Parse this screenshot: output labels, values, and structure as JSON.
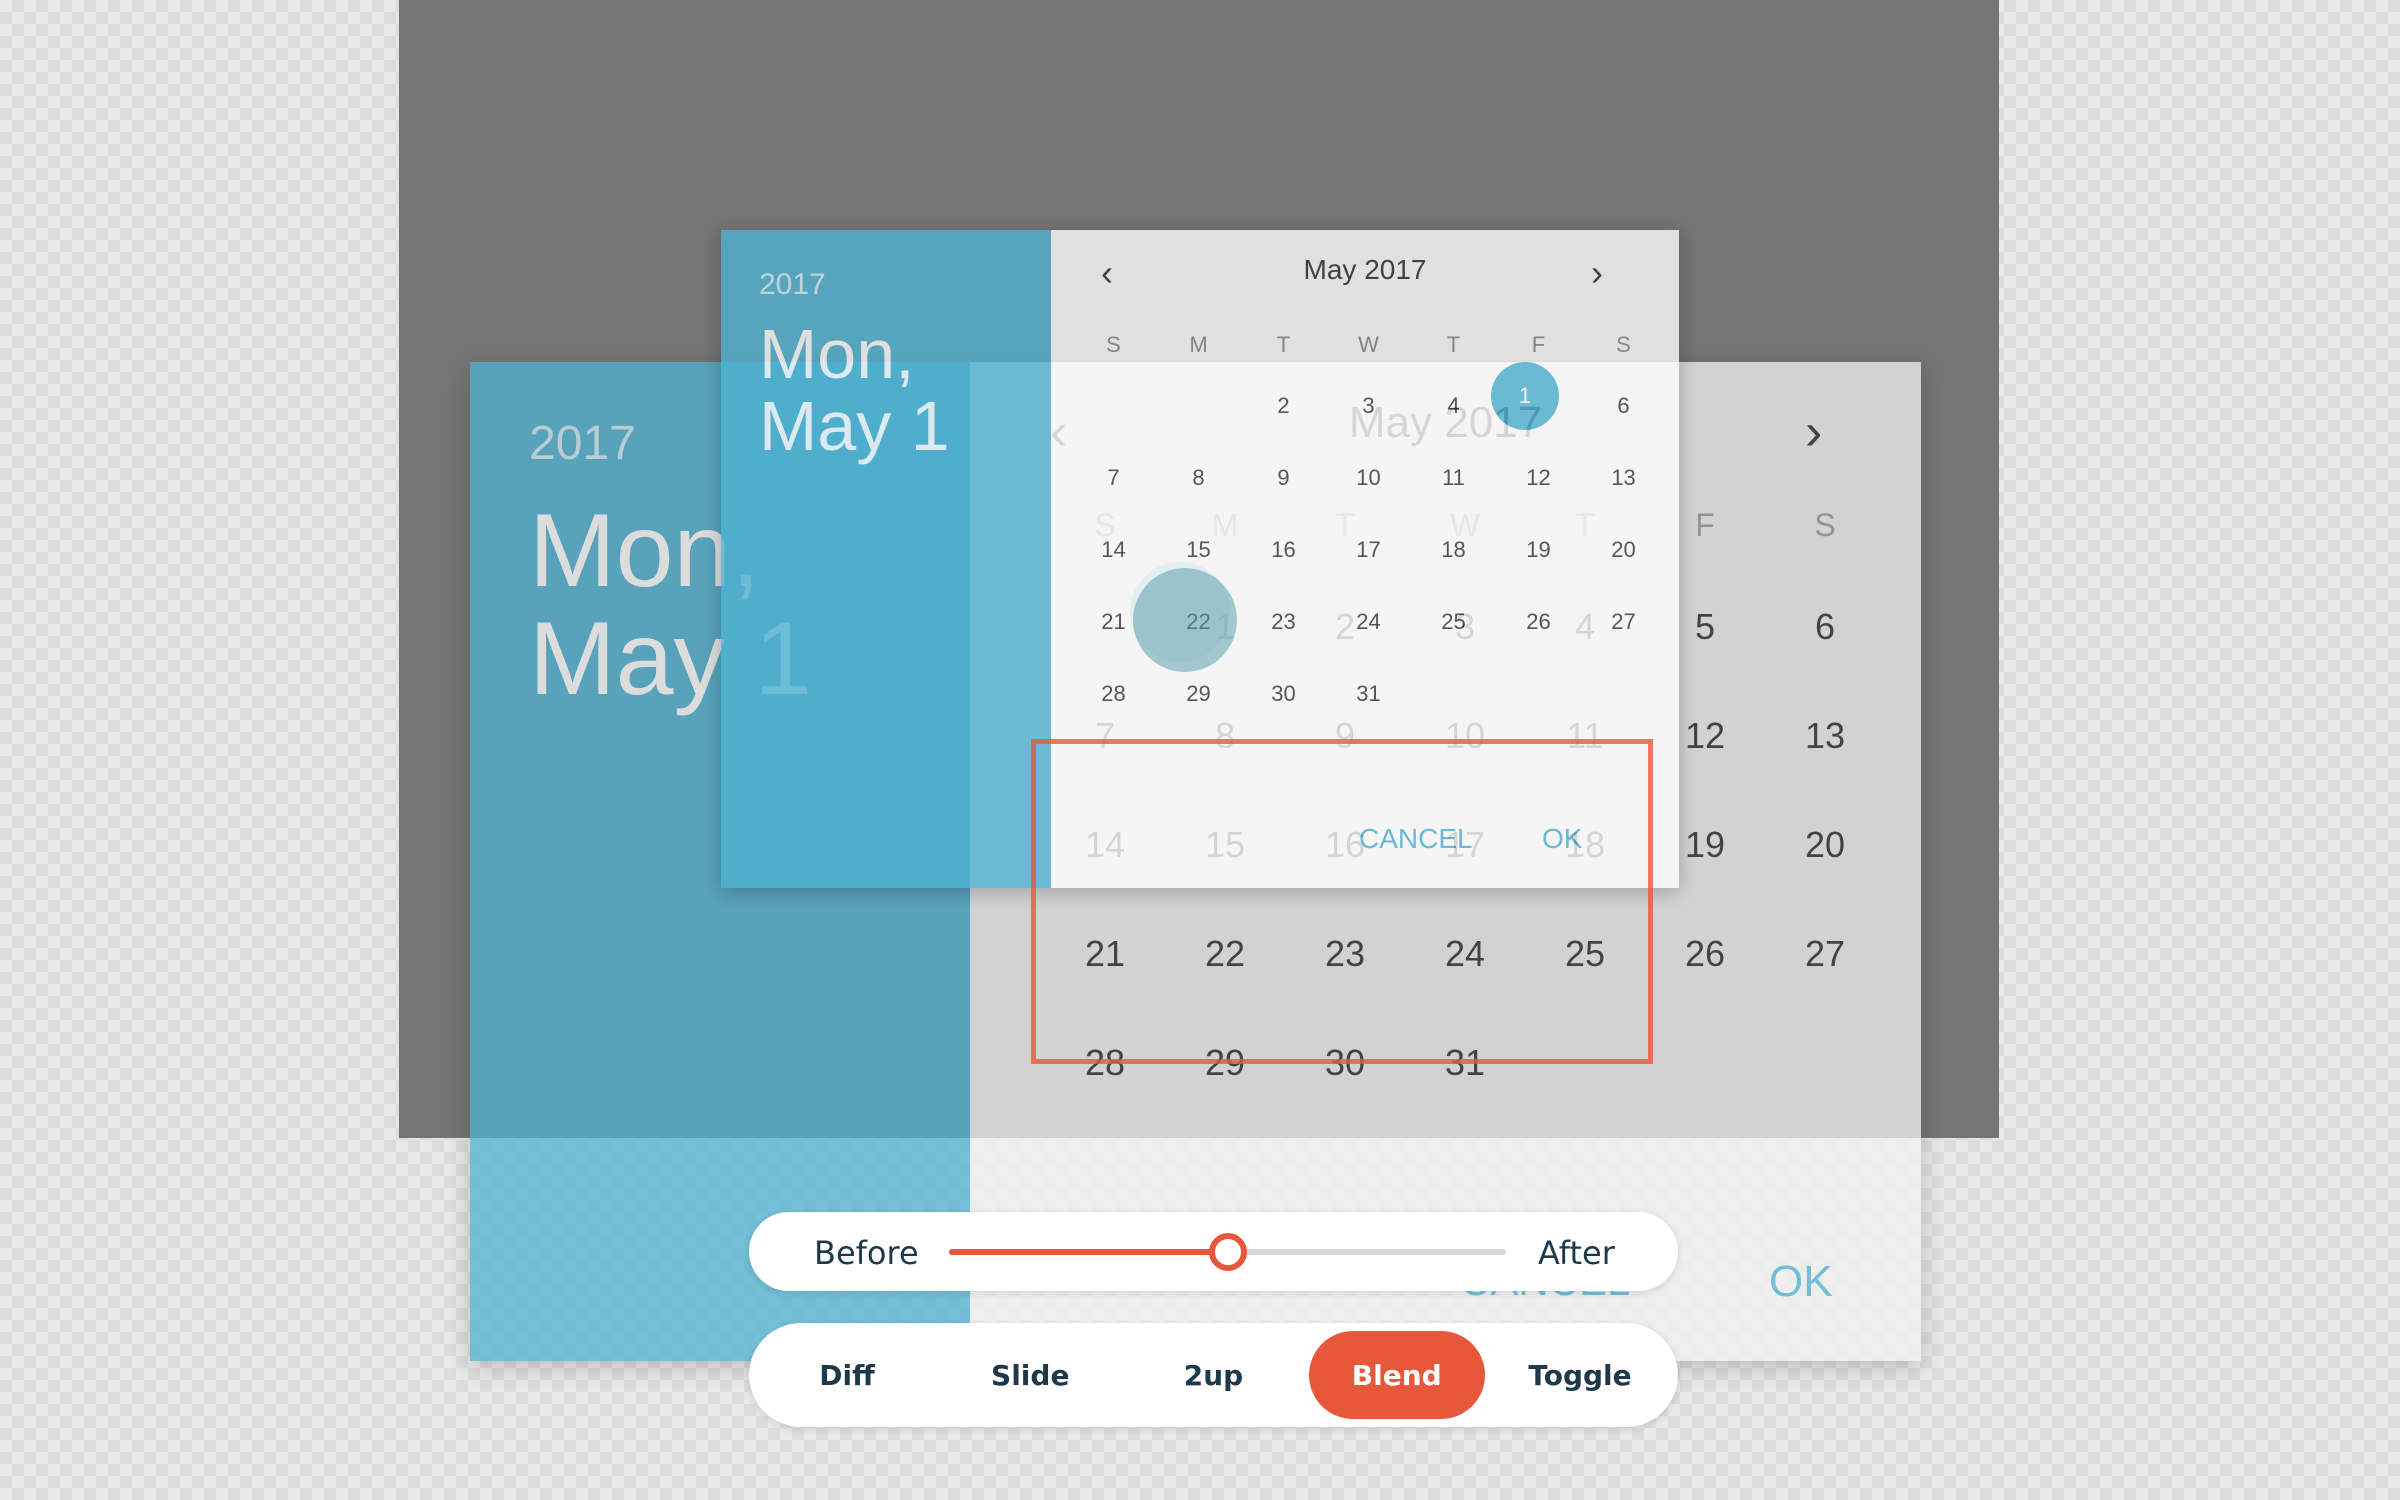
{
  "backdrop": {},
  "after_dialog": {
    "year": "2017",
    "date_line1": "Mon,",
    "date_line2": "May 1",
    "month_title": "May 2017",
    "prev_icon": "‹",
    "next_icon": "›",
    "weekdays": [
      "S",
      "M",
      "T",
      "W",
      "T",
      "F",
      "S"
    ],
    "weeks": [
      [
        "",
        "1",
        "2",
        "3",
        "4",
        "5",
        "6"
      ],
      [
        "7",
        "8",
        "9",
        "10",
        "11",
        "12",
        "13"
      ],
      [
        "14",
        "15",
        "16",
        "17",
        "18",
        "19",
        "20"
      ],
      [
        "21",
        "22",
        "23",
        "24",
        "25",
        "26",
        "27"
      ],
      [
        "28",
        "29",
        "30",
        "31",
        "",
        "",
        ""
      ]
    ],
    "cancel_label": "CANCEL",
    "ok_label": "OK"
  },
  "before_dialog": {
    "year": "2017",
    "date_line1": "Mon,",
    "date_line2": "May 1",
    "month_title": "May 2017",
    "prev_icon": "‹",
    "next_icon": "›",
    "weekdays": [
      "S",
      "M",
      "T",
      "W",
      "T",
      "F",
      "S"
    ],
    "weeks": [
      [
        "",
        "1",
        "2",
        "3",
        "4",
        "5",
        "6"
      ],
      [
        "7",
        "8",
        "9",
        "10",
        "11",
        "12",
        "13"
      ],
      [
        "14",
        "15",
        "16",
        "17",
        "18",
        "19",
        "20"
      ],
      [
        "21",
        "22",
        "23",
        "24",
        "25",
        "26",
        "27"
      ],
      [
        "28",
        "29",
        "30",
        "31",
        "",
        "",
        ""
      ]
    ],
    "selected_day": "1",
    "cancel_label": "CANCEL",
    "ok_label": "OK"
  },
  "slider": {
    "before_label": "Before",
    "after_label": "After",
    "value": 0.5
  },
  "modes": [
    {
      "label": "Diff",
      "active": false
    },
    {
      "label": "Slide",
      "active": false
    },
    {
      "label": "2up",
      "active": false
    },
    {
      "label": "Blend",
      "active": true
    },
    {
      "label": "Toggle",
      "active": false
    }
  ],
  "colors": {
    "accent": "#e7573a",
    "dialog_header": "#4fb2d3"
  }
}
